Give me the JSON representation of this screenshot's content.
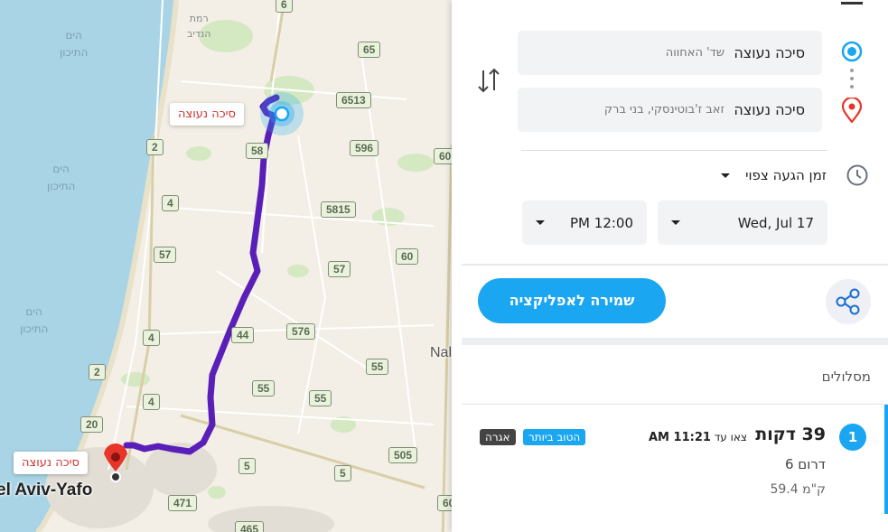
{
  "map": {
    "sea_labels": [
      {
        "top": "הים",
        "bottom": "התיכון"
      },
      {
        "top": "הים",
        "bottom": "התיכון"
      },
      {
        "top": "הים",
        "bottom": "התיכון"
      }
    ],
    "town_label": {
      "top": "רמת",
      "bottom": "הנדיב"
    },
    "partial_label": "Nal",
    "city_label": "el Aviv-Yafo",
    "start_pin_label": "סיכה נעוצה",
    "end_pin_label": "סיכה נעוצה",
    "road_shields": [
      "6",
      "65",
      "6513",
      "596",
      "60",
      "2",
      "58",
      "4",
      "5815",
      "57",
      "57",
      "60",
      "4",
      "576",
      "44",
      "2",
      "55",
      "4",
      "55",
      "55",
      "20",
      "505",
      "5",
      "5",
      "471",
      "465",
      "60"
    ],
    "route_color": "#5a1fb8"
  },
  "panel": {
    "origin": {
      "main": "סיכה נעוצה",
      "sub": "שד' האחווה"
    },
    "destination": {
      "main": "סיכה נעוצה",
      "sub": "זאב ז'בוטינסקי, בני ברק"
    },
    "time_mode": "זמן הגעה צפוי",
    "date_value": "Wed, Jul 17",
    "time_value": "PM 12:00",
    "save_button": "שמירה לאפליקציה",
    "routes_header": "מסלולים",
    "route": {
      "index": "1",
      "duration": "39 דקות",
      "arrive_prefix": "צאו עד",
      "arrive_time": "11:21 AM",
      "badge_best": "הטוב ביותר",
      "badge_toll": "אגרה",
      "via": "6 דרום",
      "distance": "59.4 ק\"מ"
    },
    "colors": {
      "accent": "#1aa6f0",
      "origin_icon": "#1aa6f0",
      "dest_icon": "#e8352a",
      "best_badge": "#1aa6f0",
      "toll_badge": "#444444"
    },
    "icons": [
      "menu-icon",
      "origin-circle-icon",
      "destination-pin-icon",
      "swap-icon",
      "clock-icon",
      "share-icon",
      "chevron-down-icon"
    ]
  }
}
